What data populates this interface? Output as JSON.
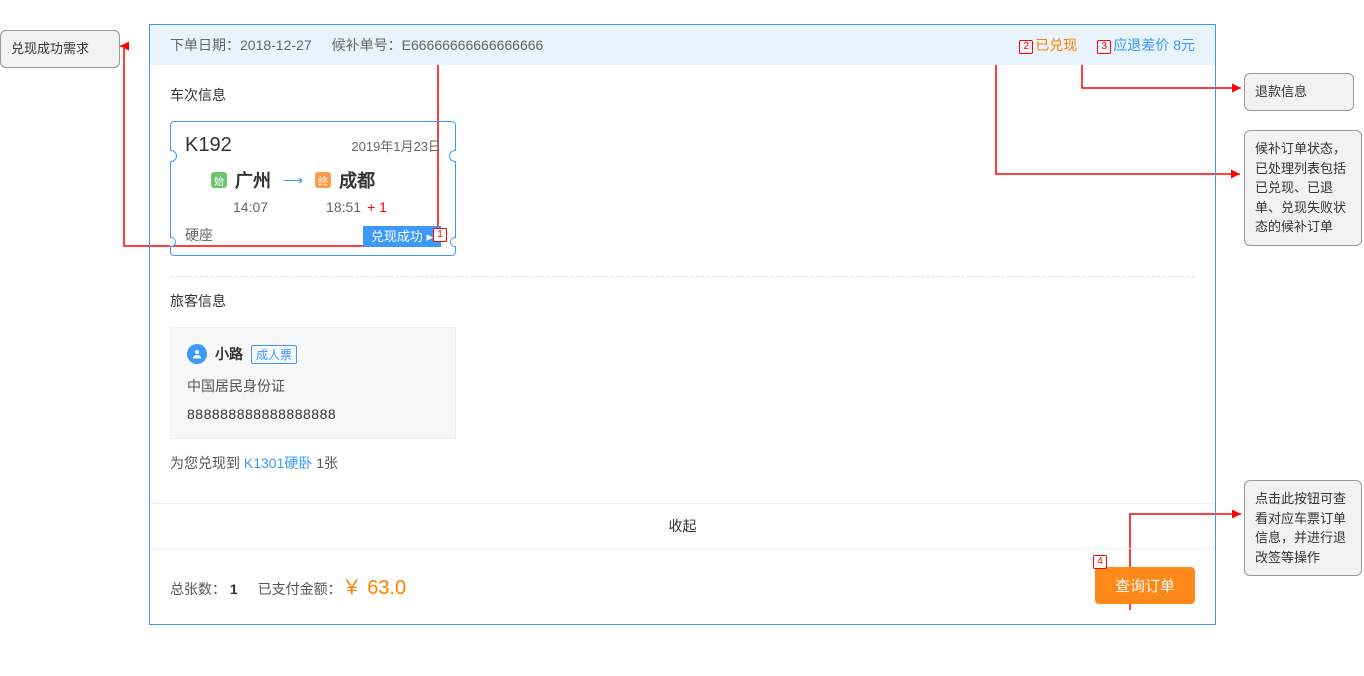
{
  "header": {
    "order_date_label": "下单日期：",
    "order_date": "2018-12-27",
    "waitlist_label": "候补单号：",
    "waitlist_no": "E66666666666666666",
    "status": "已兑现",
    "refund_label": "应退差价",
    "refund_amount": "8元"
  },
  "train_section": {
    "title": "车次信息",
    "train_no": "K192",
    "date": "2019年1月23日",
    "from_badge": "始",
    "from": "广州",
    "to_badge": "终",
    "to": "成都",
    "depart_time": "14:07",
    "arrive_time": "18:51",
    "plus_day": "+ 1",
    "seat": "硬座",
    "success_label": "兑现成功 ▸"
  },
  "passenger": {
    "title": "旅客信息",
    "name": "小路",
    "ticket_type": "成人票",
    "id_type": "中国居民身份证",
    "id_number": "888888888888888888",
    "secured_prefix": "为您兑现到 ",
    "secured_highlight": "K1301硬卧",
    "secured_suffix": " 1张"
  },
  "collapse": "收起",
  "footer": {
    "total_label": "总张数：",
    "total_count": "1",
    "paid_label": "已支付金额：",
    "currency": "￥",
    "amount": "63.0",
    "query_btn": "查询订单"
  },
  "annotations": {
    "a1": "兑现成功需求",
    "a2": "退款信息",
    "a3": "候补订单状态，已处理列表包括已兑现、已退单、兑现失败状态的候补订单",
    "a4": "点击此按钮可查看对应车票订单信息，并进行退改签等操作",
    "n1": "1",
    "n2": "2",
    "n3": "3",
    "n4": "4"
  }
}
